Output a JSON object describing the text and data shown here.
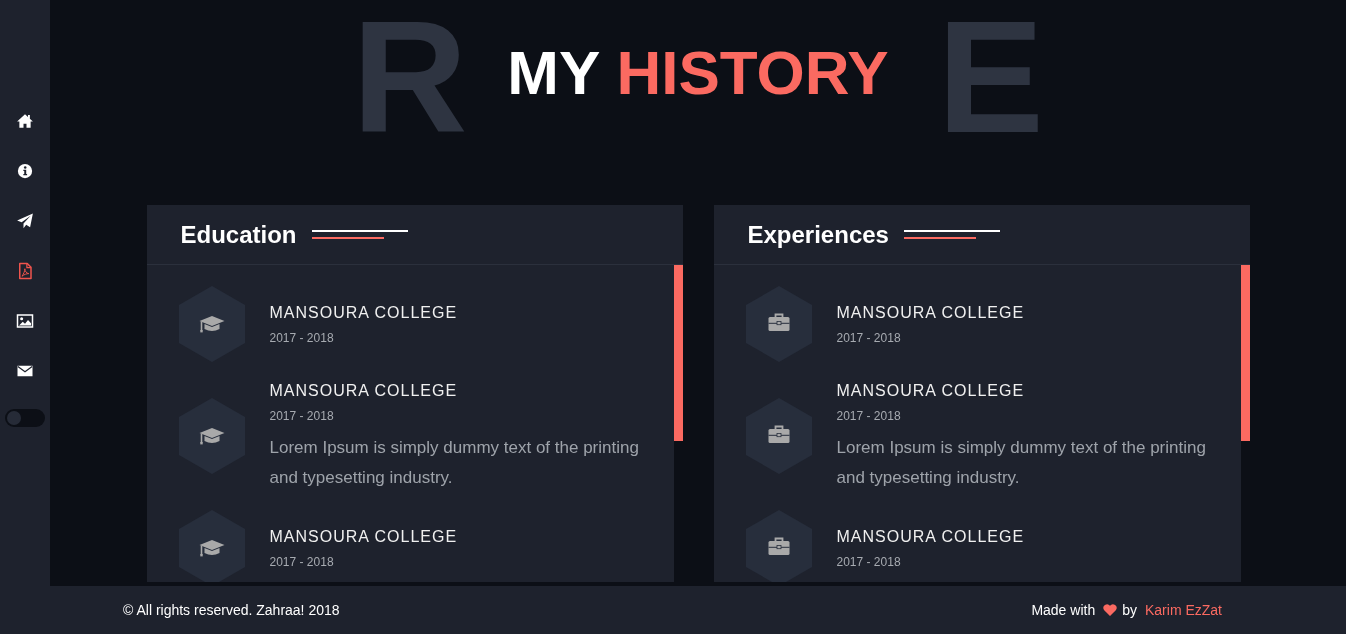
{
  "page": {
    "background_letters": [
      "R",
      "E"
    ],
    "title": {
      "text": "MY",
      "accent": "HISTORY"
    }
  },
  "sidebar": {
    "items": [
      {
        "selected": false
      },
      {
        "selected": false
      },
      {
        "selected": false
      },
      {
        "selected": true
      },
      {
        "selected": false
      },
      {
        "selected": false
      }
    ],
    "theme_toggle": {
      "on": false
    }
  },
  "sections": [
    {
      "kind": "education",
      "title": "Education",
      "items": [
        {
          "title": "MANSOURA COLLEGE",
          "date": "2017 - 2018"
        },
        {
          "title": "MANSOURA COLLEGE",
          "date": "2017 - 2018",
          "description": "Lorem Ipsum is simply dummy text of the printing and typesetting industry."
        },
        {
          "title": "MANSOURA COLLEGE",
          "date": "2017 - 2018"
        }
      ]
    },
    {
      "kind": "experience",
      "title": "Experiences",
      "items": [
        {
          "title": "MANSOURA COLLEGE",
          "date": "2017 - 2018"
        },
        {
          "title": "MANSOURA COLLEGE",
          "date": "2017 - 2018",
          "description": "Lorem Ipsum is simply dummy text of the printing and typesetting industry."
        },
        {
          "title": "MANSOURA COLLEGE",
          "date": "2017 - 2018"
        }
      ]
    }
  ],
  "footer": {
    "copyright": "© All rights reserved. Zahraa! 2018",
    "made_with": "Made with",
    "by": "by",
    "author": "Karim EzZat"
  }
}
